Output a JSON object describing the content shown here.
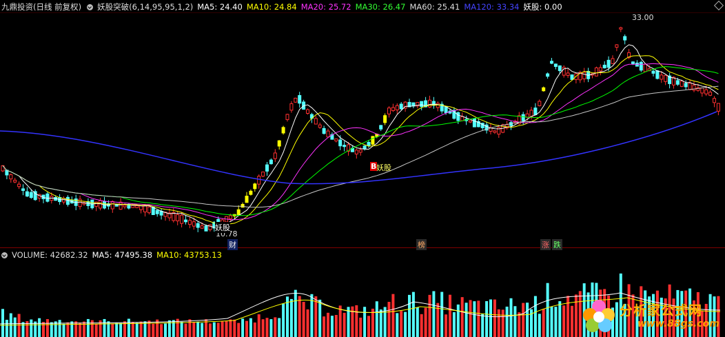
{
  "header": {
    "title": "九鼎投资(日线 前复权)",
    "indicator": "妖股突破(6,14,95,95,1,2)",
    "ma5": "MA5: 24.40",
    "ma10": "MA10: 24.84",
    "ma20": "MA20: 25.72",
    "ma30": "MA30: 26.47",
    "ma60": "MA60: 25.41",
    "ma120": "MA120: 33.34",
    "yaogu": "妖股: 0.00"
  },
  "volume_header": {
    "title": "VOLUME: 42682.32",
    "ma5": "MA5: 47495.38",
    "ma10": "MA10: 43753.13"
  },
  "annotations": {
    "high_price": "33.00",
    "low_price": "10.78",
    "signal1": "妖股",
    "signal2": "妖股",
    "b_mark": "B"
  },
  "categories": {
    "cai": "财",
    "bang": "榜",
    "zhang": "涨",
    "die": "跌"
  },
  "watermark": {
    "name": "分析家公式网",
    "url": "www.88gs.com"
  },
  "colors": {
    "up": "#ff3030",
    "down": "#54ffff",
    "signal": "#ffff00",
    "ma5": "#ffffff",
    "ma10": "#ffff00",
    "ma20": "#ff33ff",
    "ma30": "#00ff00",
    "ma60": "#c8c8c8",
    "ma120": "#3333ff"
  }
}
